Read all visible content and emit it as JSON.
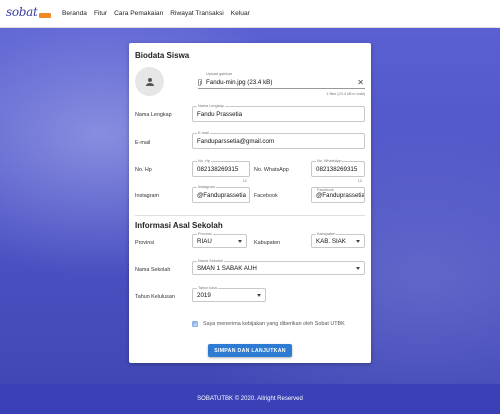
{
  "navbar": {
    "logo_text": "sobat",
    "links": [
      "Beranda",
      "Fitur",
      "Cara Pemakaian",
      "Riwayat Transaksi",
      "Keluar"
    ]
  },
  "form": {
    "section1_title": "Biodata Siswa",
    "upload": {
      "label": "Upload gambar",
      "value": "Fandu-min.jpg (23.4 kB)",
      "hint": "1 files (23.4 kB in total)"
    },
    "nama_lengkap": {
      "label": "Nama Lengkap",
      "field_label": "Nama Lengkap",
      "value": "Fandu Prassetia"
    },
    "email": {
      "label": "E-mail",
      "field_label": "E-mail",
      "value": "Fanduparssetia@gmail.com"
    },
    "no_hp": {
      "label": "No. Hp",
      "field_label": "No. Hp",
      "value": "082138269315",
      "counter": "12"
    },
    "no_whatsapp": {
      "label": "No. WhatsApp",
      "field_label": "No. WhatsApp",
      "value": "082138269315",
      "counter": "12"
    },
    "instagram": {
      "label": "Instagram",
      "field_label": "Instagram",
      "value": "@Fanduprassetia"
    },
    "facebook": {
      "label": "Facebook",
      "field_label": "Facebook",
      "value": "@Fanduprassetia"
    },
    "section2_title": "Informasi Asal Sekolah",
    "provinsi": {
      "label": "Provinsi",
      "field_label": "Provinsi",
      "value": "RIAU"
    },
    "kabupaten": {
      "label": "Kabupaten",
      "field_label": "Kabupaten",
      "value": "KAB. SIAK"
    },
    "nama_sekolah": {
      "label": "Nama Sekolah",
      "field_label": "Nama Sekolah",
      "value": "SMAN 1 SABAK AUH"
    },
    "tahun_kelulusan": {
      "label": "Tahun Kelulusan",
      "field_label": "Tahun lulus",
      "value": "2019"
    },
    "agreement": "Saya menerima kebijakan yang diberikan oleh Sobat UTBK",
    "submit_label": "SIMPAN DAN LANJUTKAN"
  },
  "footer": {
    "text": "SOBATUTBK © 2020. Allright Reserved"
  },
  "colors": {
    "primary": "#2e7bd4",
    "navbar_bg": "#ffffff",
    "overlay": "#4f55c9",
    "footer": "#3a41b6",
    "logo_accent": "#f08a24"
  }
}
